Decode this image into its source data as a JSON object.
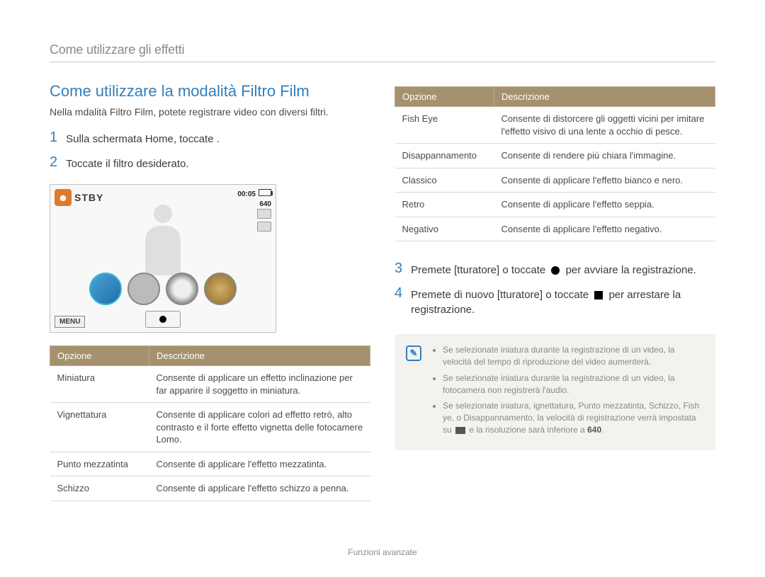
{
  "header": "Come utilizzare gli effetti",
  "title": "Come utilizzare la modalità Filtro Film",
  "intro": "Nella mdalità Filtro Film, potete registrare video con diversi filtri.",
  "steps": {
    "1": "Sulla schermata Home, toccate      .",
    "2": "Toccate il filtro desiderato.",
    "3_a": "Premete [",
    "3_shutter": "tturatore",
    "3_b": "] o toccate ",
    "3_c": " per avviare la registrazione.",
    "4_a": "Premete di nuovo [",
    "4_shutter": "tturatore",
    "4_b": "] o toccate ",
    "4_c": " per arrestare la registrazione."
  },
  "screen": {
    "stby": "STBY",
    "time": "00:05",
    "res": "640",
    "menu": "MENU"
  },
  "table_headers": {
    "opt": "Opzione",
    "desc": "Descrizione"
  },
  "table_left": [
    {
      "opt": "Miniatura",
      "desc": "Consente di applicare un effetto inclinazione per far apparire il soggetto in miniatura."
    },
    {
      "opt": "Vignettatura",
      "desc": "Consente di applicare colori ad effetto retrò, alto contrasto e il forte effetto vignetta delle fotocamere Lomo."
    },
    {
      "opt": "Punto mezzatinta",
      "desc": "Consente di applicare l'effetto mezzatinta."
    },
    {
      "opt": "Schizzo",
      "desc": "Consente di applicare l'effetto schizzo a penna."
    }
  ],
  "table_right": [
    {
      "opt": "Fish Eye",
      "desc": "Consente di distorcere gli oggetti vicini per imitare l'effetto visivo di una lente a occhio di pesce."
    },
    {
      "opt": "Disappannamento",
      "desc": "Consente di rendere più chiara l'immagine."
    },
    {
      "opt": "Classico",
      "desc": "Consente di applicare l'effetto bianco e nero."
    },
    {
      "opt": "Retro",
      "desc": "Consente di applicare l'effetto seppia."
    },
    {
      "opt": "Negativo",
      "desc": "Consente di applicare l'effetto negativo."
    }
  ],
  "note": {
    "items": [
      "Se selezionate iniatura durante la registrazione di un video, la velocità del tempo di riproduzione del video aumenterà.",
      "Se selezionate iniatura durante la registrazione di un video, la fotocamera non registrerà l'audio.",
      "Se selezionate iniatura, ignettatura, Punto mezzatinta, Schizzo, Fish ye, o Disappannamento, la velocità di registrazione verrà impostata su "
    ],
    "tail_a": " e la risoluzione sarà inferiore a ",
    "tail_b": "640",
    "tail_c": "."
  },
  "footer": "Funzioni avanzate"
}
